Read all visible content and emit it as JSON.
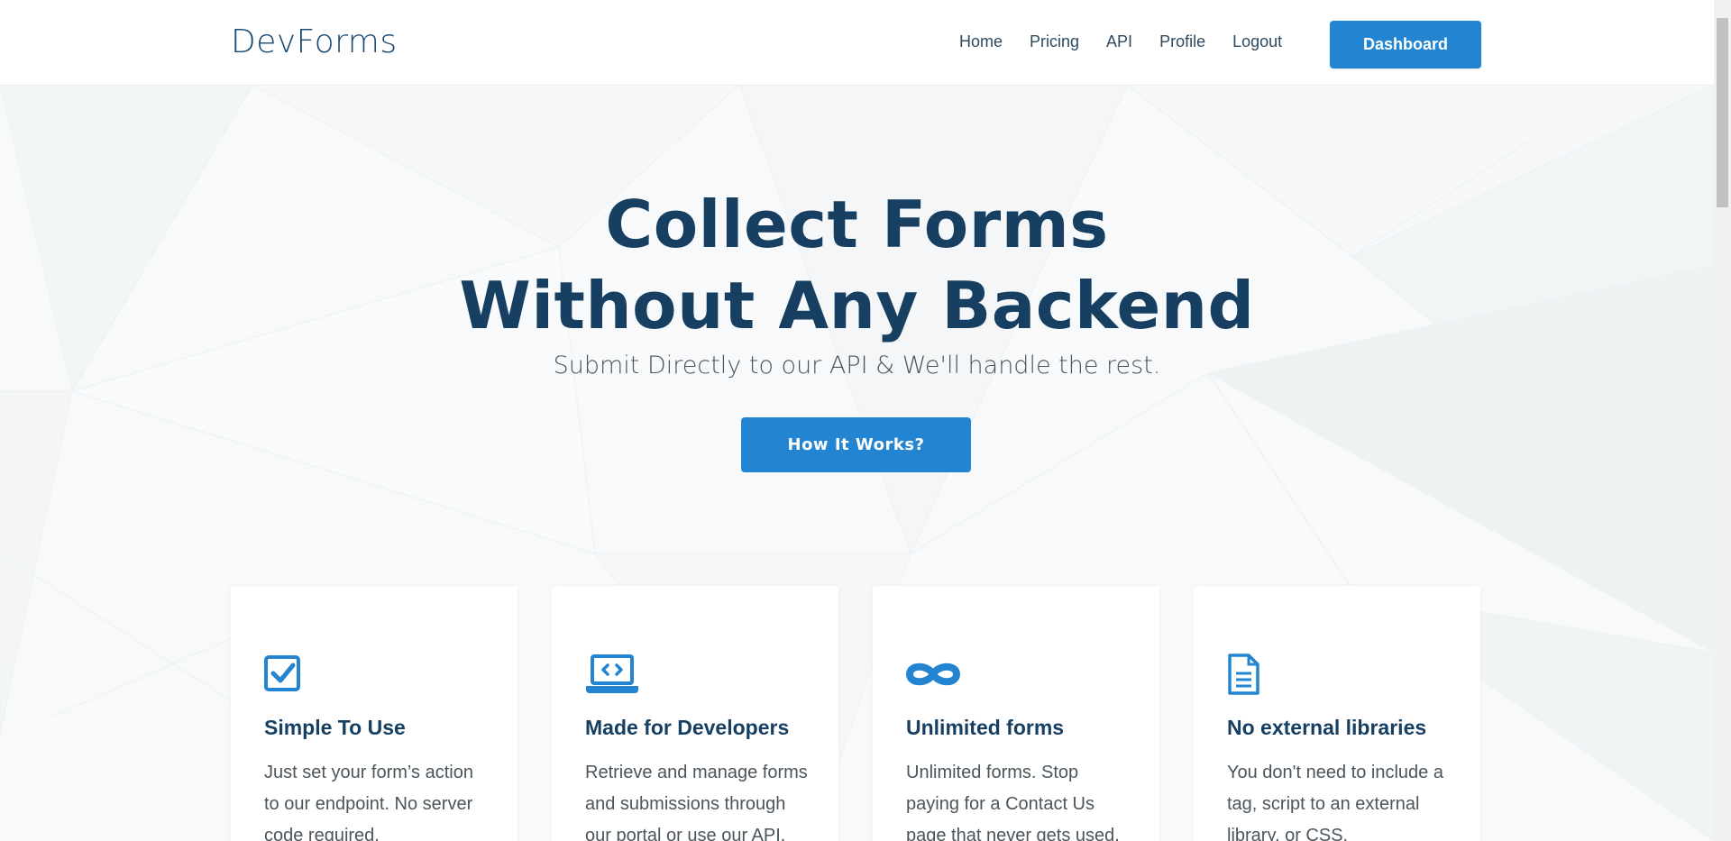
{
  "header": {
    "logo": "DevForms",
    "nav": [
      "Home",
      "Pricing",
      "API",
      "Profile",
      "Logout"
    ],
    "dashboard_label": "Dashboard"
  },
  "hero": {
    "title_line1": "Collect Forms",
    "title_line2": "Without Any Backend",
    "subtitle": "Submit Directly to our API & We'll handle the rest.",
    "cta_label": "How It Works?"
  },
  "features": [
    {
      "icon": "check-square-icon",
      "title": "Simple To Use",
      "text": "Just set your form’s action to our endpoint. No server code required."
    },
    {
      "icon": "laptop-code-icon",
      "title": "Made for Developers",
      "text": "Retrieve and manage forms and submissions through our portal or use our API."
    },
    {
      "icon": "infinity-icon",
      "title": "Unlimited forms",
      "text": "Unlimited forms. Stop paying for a Contact Us page that never gets used."
    },
    {
      "icon": "document-icon",
      "title": "No external libraries",
      "text": "You don't need to include a tag, script to an external library, or CSS."
    }
  ],
  "colors": {
    "brand": "#2385d1",
    "heading": "#163f62",
    "text": "#4b555c"
  }
}
